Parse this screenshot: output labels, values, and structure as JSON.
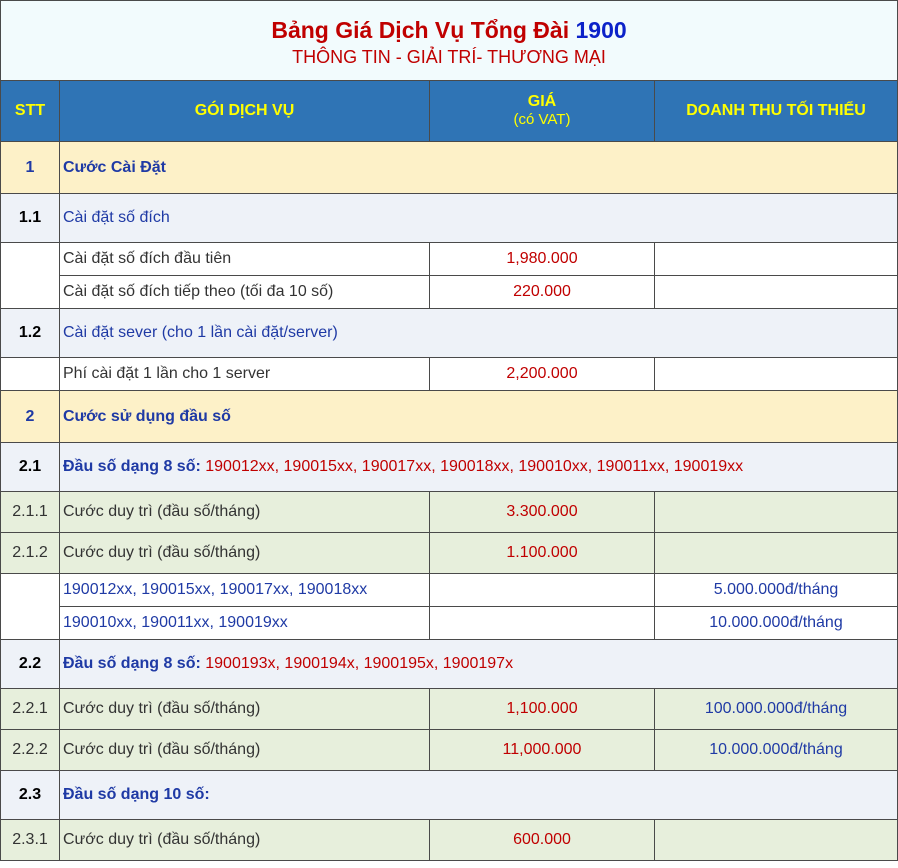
{
  "title": {
    "main": "Bảng Giá Dịch Vụ Tổng Đài",
    "number": "1900",
    "subtitle": "THÔNG TIN - GIẢI TRÍ- THƯƠNG MẠI"
  },
  "headers": {
    "stt": "STT",
    "service": "GÓI DỊCH VỤ",
    "price": "GIÁ",
    "price_note": "(có VAT)",
    "revenue": "DOANH THU TỐI THIỂU"
  },
  "rows": {
    "r1": {
      "stt": "1",
      "service": "Cước Cài Đặt"
    },
    "r1_1": {
      "stt": "1.1",
      "service": "Cài đặt số đích"
    },
    "r1_1a": {
      "service": "Cài đặt số đích đầu tiên",
      "price": "1,980.000"
    },
    "r1_1b": {
      "service": "Cài đặt số đích tiếp theo (tối đa 10 số)",
      "price": "220.000"
    },
    "r1_2": {
      "stt": "1.2",
      "service": "Cài đặt sever (cho 1 lần cài đặt/server)"
    },
    "r1_2a": {
      "service": "Phí cài đặt 1 lần cho 1 server",
      "price": "2,200.000"
    },
    "r2": {
      "stt": "2",
      "service": "Cước sử dụng đầu số"
    },
    "r2_1": {
      "stt": "2.1",
      "service": "Đầu số dạng 8 số:",
      "numbers": " 190012xx, 190015xx, 190017xx, 190018xx, 190010xx, 190011xx, 190019xx"
    },
    "r2_1_1": {
      "stt": "2.1.1",
      "service": "Cước duy trì  (đầu số/tháng)",
      "price": "3.300.000"
    },
    "r2_1_2": {
      "stt": "2.1.2",
      "service": "Cước duy trì  (đầu số/tháng)",
      "price": "1.100.000"
    },
    "r2_1a": {
      "service": "190012xx, 190015xx, 190017xx, 190018xx",
      "revenue": "5.000.000đ/tháng"
    },
    "r2_1b": {
      "service": "190010xx, 190011xx, 190019xx",
      "revenue": "10.000.000đ/tháng"
    },
    "r2_2": {
      "stt": "2.2",
      "service": "Đầu số dạng 8 số:",
      "numbers": " 1900193x, 1900194x, 1900195x, 1900197x"
    },
    "r2_2_1": {
      "stt": "2.2.1",
      "service": "Cước duy trì  (đầu số/tháng)",
      "price": "1,100.000",
      "revenue": "100.000.000đ/tháng"
    },
    "r2_2_2": {
      "stt": "2.2.2",
      "service": "Cước duy trì  (đầu số/tháng)",
      "price": "11,000.000",
      "revenue": "10.000.000đ/tháng"
    },
    "r2_3": {
      "stt": "2.3",
      "service": "Đầu số dạng 10 số:"
    },
    "r2_3_1": {
      "stt": "2.3.1",
      "service": "Cước duy trì  (đầu số/tháng)",
      "price": "600.000"
    }
  },
  "colors": {
    "header_bg": "#2f74b5",
    "header_text": "#ffff00",
    "section_bg": "#fdf1c8",
    "subsection_bg": "#eef2f8",
    "green_bg": "#e7efdc",
    "price_text": "#c00000",
    "blue_text": "#1f3aa5"
  }
}
